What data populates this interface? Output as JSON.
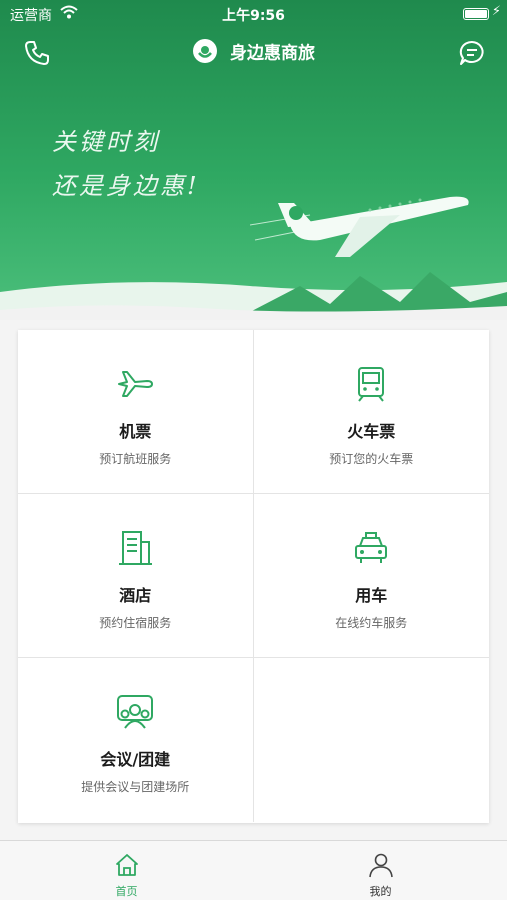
{
  "status_bar": {
    "carrier": "运营商",
    "time": "上午9:56"
  },
  "header": {
    "brand": "身边惠商旅"
  },
  "hero": {
    "slogan_line1": "关键时刻",
    "slogan_line2": "还是身边惠!"
  },
  "services": [
    {
      "title": "机票",
      "subtitle": "预订航班服务",
      "icon": "plane-icon"
    },
    {
      "title": "火车票",
      "subtitle": "预订您的火车票",
      "icon": "train-icon"
    },
    {
      "title": "酒店",
      "subtitle": "预约住宿服务",
      "icon": "hotel-icon"
    },
    {
      "title": "用车",
      "subtitle": "在线约车服务",
      "icon": "taxi-icon"
    },
    {
      "title": "会议/团建",
      "subtitle": "提供会议与团建场所",
      "icon": "meeting-icon"
    }
  ],
  "tabbar": {
    "home": "首页",
    "mine": "我的"
  },
  "colors": {
    "accent": "#2fa862",
    "hero_dark": "#1f8a4d",
    "hero_light": "#4cc07c"
  }
}
